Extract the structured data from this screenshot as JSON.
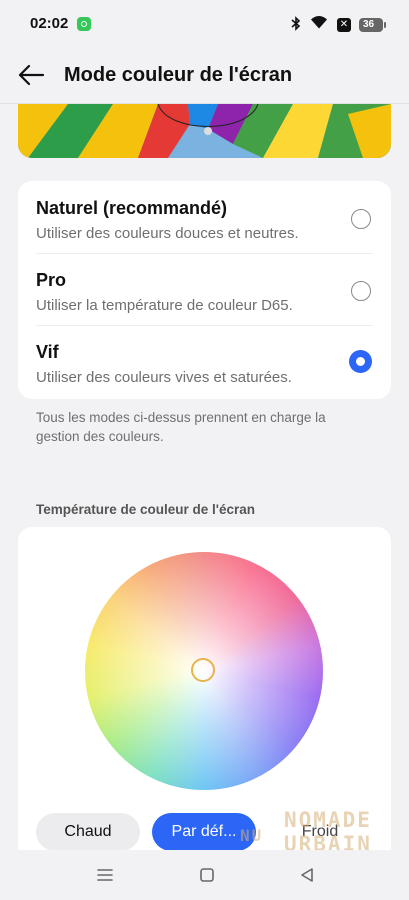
{
  "status_bar": {
    "time": "02:02",
    "battery": "36",
    "icons": [
      "app-notification-icon",
      "bluetooth-icon",
      "wifi-icon",
      "x-close-app-icon",
      "battery-icon"
    ]
  },
  "header": {
    "title": "Mode couleur de l'écran",
    "back_icon": "arrow-left-icon"
  },
  "modes": [
    {
      "title": "Naturel (recommandé)",
      "description": "Utiliser des couleurs douces et neutres.",
      "selected": false
    },
    {
      "title": "Pro",
      "description": "Utiliser la température de couleur D65.",
      "selected": false
    },
    {
      "title": "Vif",
      "description": "Utiliser des couleurs vives et saturées.",
      "selected": true
    }
  ],
  "footnote": "Tous les modes ci-dessus prennent en charge la gestion des couleurs.",
  "temperature": {
    "section_label": "Température de couleur de l'écran",
    "presets": [
      {
        "label": "Chaud",
        "selected": false
      },
      {
        "label": "Par déf...",
        "selected": true
      },
      {
        "label": "Froid",
        "selected": false
      }
    ]
  },
  "watermark": {
    "line1": "NOMADE",
    "line2": "URBAIN",
    "prefix": "NU"
  },
  "nav_bar": {
    "icons": [
      "menu-icon",
      "home-square-icon",
      "back-triangle-icon"
    ]
  },
  "colors": {
    "accent": "#2b66f6",
    "background": "#f2f2f4",
    "card": "#ffffff",
    "handle": "#e8b34b"
  }
}
